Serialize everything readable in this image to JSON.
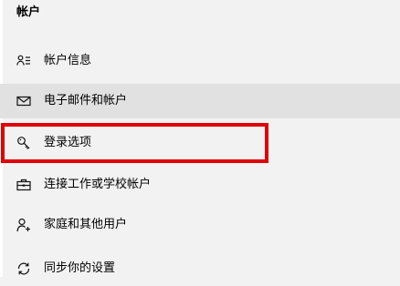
{
  "section": {
    "title": "帐户"
  },
  "nav": {
    "items": [
      {
        "label": "帐户信息",
        "icon": "user-info-icon"
      },
      {
        "label": "电子邮件和帐户",
        "icon": "mail-icon"
      },
      {
        "label": "登录选项",
        "icon": "key-icon"
      },
      {
        "label": "连接工作或学校帐户",
        "icon": "briefcase-icon"
      },
      {
        "label": "家庭和其他用户",
        "icon": "person-add-icon"
      },
      {
        "label": "同步你的设置",
        "icon": "sync-icon"
      }
    ]
  },
  "colors": {
    "background": "#f2f2f2",
    "selected_row": "#e1e1e1",
    "highlight_border": "#e00000"
  }
}
